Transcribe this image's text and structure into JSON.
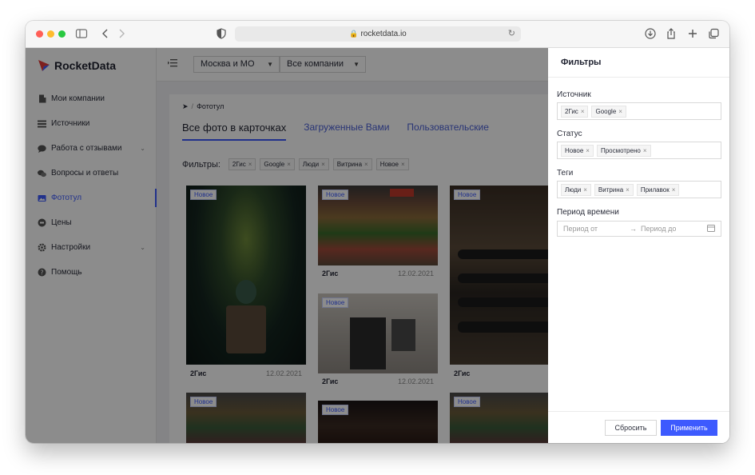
{
  "browser": {
    "url": "rocketdata.io"
  },
  "sidebar": {
    "logo": "RocketData",
    "items": [
      {
        "label": "Мои компании",
        "icon": "building-icon"
      },
      {
        "label": "Источники",
        "icon": "list-icon"
      },
      {
        "label": "Работа с отзывами",
        "icon": "chat-bubble-icon",
        "expandable": true
      },
      {
        "label": "Вопросы и ответы",
        "icon": "chat-bubbles-icon"
      },
      {
        "label": "Фототул",
        "icon": "image-icon",
        "active": true
      },
      {
        "label": "Цены",
        "icon": "tag-icon"
      },
      {
        "label": "Настройки",
        "icon": "gear-icon",
        "expandable": true
      },
      {
        "label": "Помощь",
        "icon": "question-icon"
      }
    ]
  },
  "topbar": {
    "region": "Москва и МО",
    "company": "Все компании"
  },
  "page": {
    "breadcrumb": "Фототул",
    "tabs": [
      "Все фото в карточках",
      "Загруженные Вами",
      "Пользовательские"
    ],
    "filters_label": "Фильтры:",
    "filter_chips": [
      "2Гис",
      "Google",
      "Люди",
      "Витрина",
      "Новое"
    ],
    "photos": [
      {
        "badge": "Новое",
        "source": "2Гис",
        "date": "12.02.2021"
      },
      {
        "badge": "Новое",
        "source": "2Гис",
        "date": "12.02.2021"
      },
      {
        "badge": "Новое",
        "source": "2Гис",
        "date": "12.02.2021"
      },
      {
        "badge": "Новое",
        "source": "2Гис",
        "date": ""
      },
      {
        "badge": "Новое",
        "source": "",
        "date": ""
      },
      {
        "badge": "Новое",
        "source": "",
        "date": ""
      },
      {
        "badge": "Новое",
        "source": "",
        "date": ""
      }
    ]
  },
  "drawer": {
    "title": "Фильтры",
    "source_label": "Источник",
    "source_chips": [
      "2Гис",
      "Google"
    ],
    "status_label": "Статус",
    "status_chips": [
      "Новое",
      "Просмотрено"
    ],
    "tags_label": "Теги",
    "tags_chips": [
      "Люди",
      "Витрина",
      "Прилавок"
    ],
    "period_label": "Период времени",
    "period_from_placeholder": "Период от",
    "period_to_placeholder": "Период до",
    "reset_label": "Сбросить",
    "apply_label": "Применить"
  },
  "colors": {
    "accent": "#3d5afe",
    "overlay": "#000000"
  }
}
